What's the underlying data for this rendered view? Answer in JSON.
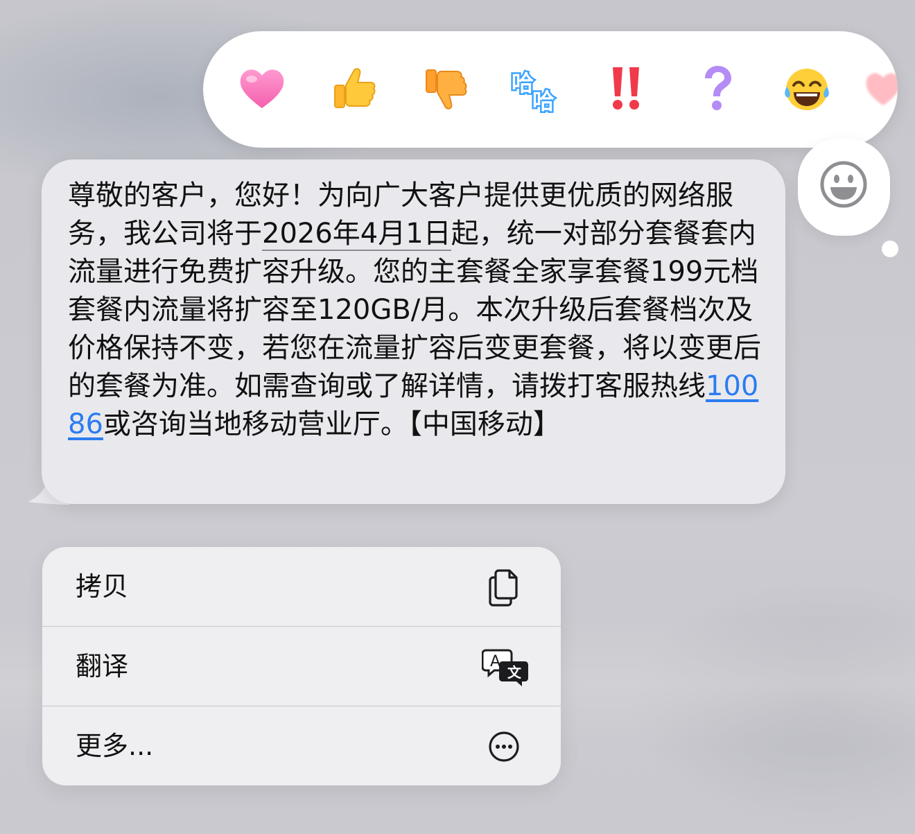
{
  "reactions": [
    {
      "name": "heart",
      "glyph": "💗"
    },
    {
      "name": "thumbs-up",
      "glyph": "👍"
    },
    {
      "name": "thumbs-down",
      "glyph": "👎"
    },
    {
      "name": "haha",
      "glyph": "哈哈"
    },
    {
      "name": "exclamation",
      "glyph": "‼️"
    },
    {
      "name": "question",
      "glyph": "❓"
    },
    {
      "name": "tears-of-joy",
      "glyph": "😂"
    },
    {
      "name": "more-reaction",
      "glyph": "❤️"
    }
  ],
  "message": {
    "part1": "尊敬的客户，您好！为向广大客户提供更优质的网络服务，我公司将于",
    "date": "2026年4月1日",
    "part2": "起，统一对部分套餐套内流量进行免费扩容升级。您的主套餐全家享套餐199元档套餐内流量将扩容至120GB/月。本次升级后套餐档次及价格保持不变，若您在流量扩容后变更套餐，将以变更后的套餐为准。如需查询或了解详情，请拨打客服热线",
    "phone": "10086",
    "part3": "或咨询当地移动营业厅。【中国移动】"
  },
  "menu": {
    "copy_label": "拷贝",
    "translate_label": "翻译",
    "more_label": "更多..."
  },
  "colors": {
    "link": "#2b7cf0",
    "bubble": "#e9e9ed",
    "menu": "#efeff1"
  }
}
